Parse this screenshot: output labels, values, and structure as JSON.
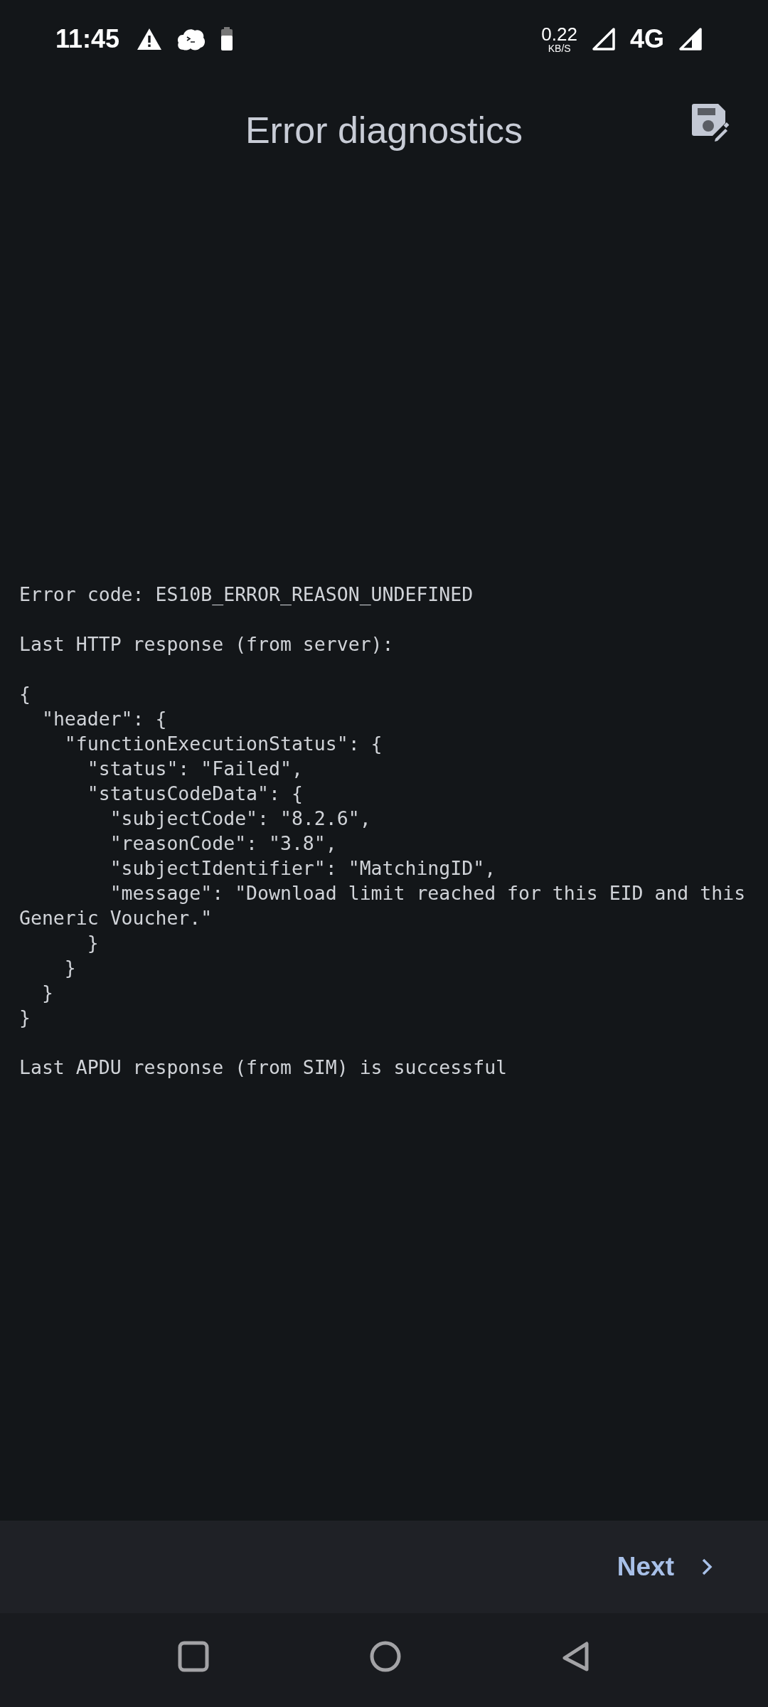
{
  "status_bar": {
    "time": "11:45",
    "speed": "0.22",
    "speed_unit": "KB/S",
    "network": "4G"
  },
  "app_bar": {
    "title": "Error diagnostics"
  },
  "diagnostics": {
    "error_code": "Error code: ES10B_ERROR_REASON_UNDEFINED",
    "http_label": "Last HTTP response (from server):",
    "http_body": [
      "{",
      "  \"header\": {",
      "    \"functionExecutionStatus\": {",
      "      \"status\": \"Failed\",",
      "      \"statusCodeData\": {",
      "        \"subjectCode\": \"8.2.6\",",
      "        \"reasonCode\": \"3.8\",",
      "        \"subjectIdentifier\": \"MatchingID\",",
      "        \"message\": \"Download limit reached for this EID and this Generic Voucher.\"",
      "      }",
      "    }",
      "  }",
      "}"
    ],
    "apdu_status": "Last APDU response (from SIM) is successful"
  },
  "bottom_bar": {
    "next_button": "Next"
  }
}
